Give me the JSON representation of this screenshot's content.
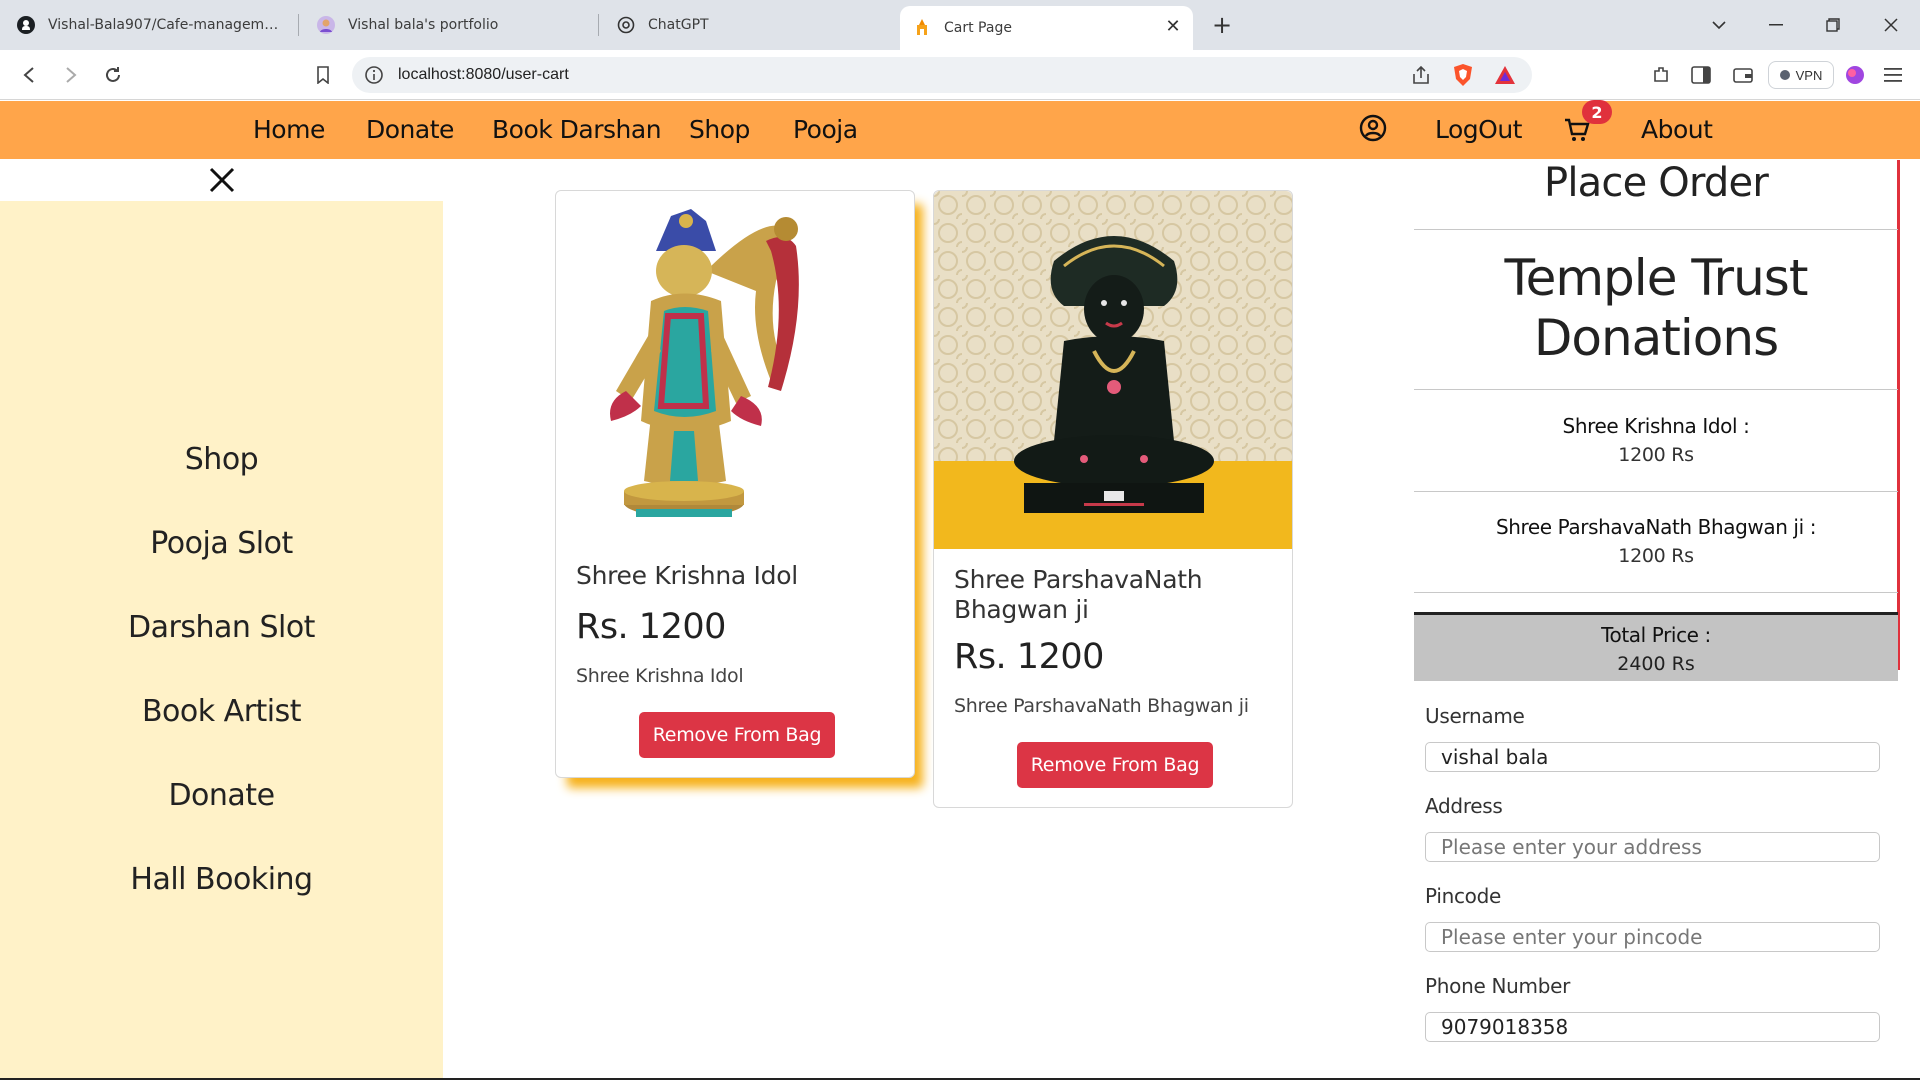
{
  "browser": {
    "tabs": [
      {
        "title": "Vishal-Bala907/Cafe-management-Syte"
      },
      {
        "title": "Vishal bala's portfolio"
      },
      {
        "title": "ChatGPT"
      },
      {
        "title": "Cart Page"
      }
    ],
    "url": "localhost:8080/user-cart",
    "vpn_label": "VPN"
  },
  "site_nav": {
    "links": [
      "Home",
      "Donate",
      "Book Darshan",
      "Shop",
      "Pooja"
    ],
    "logout": "LogOut",
    "cart_count": "2",
    "about": "About"
  },
  "sidebar": {
    "items": [
      "Shop",
      "Pooja Slot",
      "Darshan Slot",
      "Book Artist",
      "Donate",
      "Hall Booking"
    ]
  },
  "cart": {
    "items": [
      {
        "title": "Shree Krishna Idol",
        "price": "Rs. 1200",
        "desc": "Shree Krishna Idol",
        "button": "Remove From Bag"
      },
      {
        "title": "Shree ParshavaNath Bhagwan ji",
        "price": "Rs. 1200",
        "desc": "Shree ParshavaNath Bhagwan ji",
        "button": "Remove From Bag"
      }
    ]
  },
  "order": {
    "title": "Place Order",
    "heading": "Temple Trust Donations",
    "line_items": [
      {
        "name": "Shree Krishna Idol :",
        "price": "1200 Rs"
      },
      {
        "name": "Shree ParshavaNath Bhagwan ji :",
        "price": "1200 Rs"
      }
    ],
    "total_label": "Total Price :",
    "total_value": "2400 Rs",
    "fields": {
      "username": {
        "label": "Username",
        "value": "vishal bala",
        "placeholder": ""
      },
      "address": {
        "label": "Address",
        "value": "",
        "placeholder": "Please enter your address"
      },
      "pincode": {
        "label": "Pincode",
        "value": "",
        "placeholder": "Please enter your pincode"
      },
      "phone": {
        "label": "Phone Number",
        "value": "9079018358",
        "placeholder": ""
      }
    }
  },
  "colors": {
    "nav_bg": "#ffa54a",
    "sidebar_bg": "#fff2c8",
    "danger": "#dc3545",
    "badge": "#e0313c",
    "total_bg": "#c3c3c3"
  }
}
